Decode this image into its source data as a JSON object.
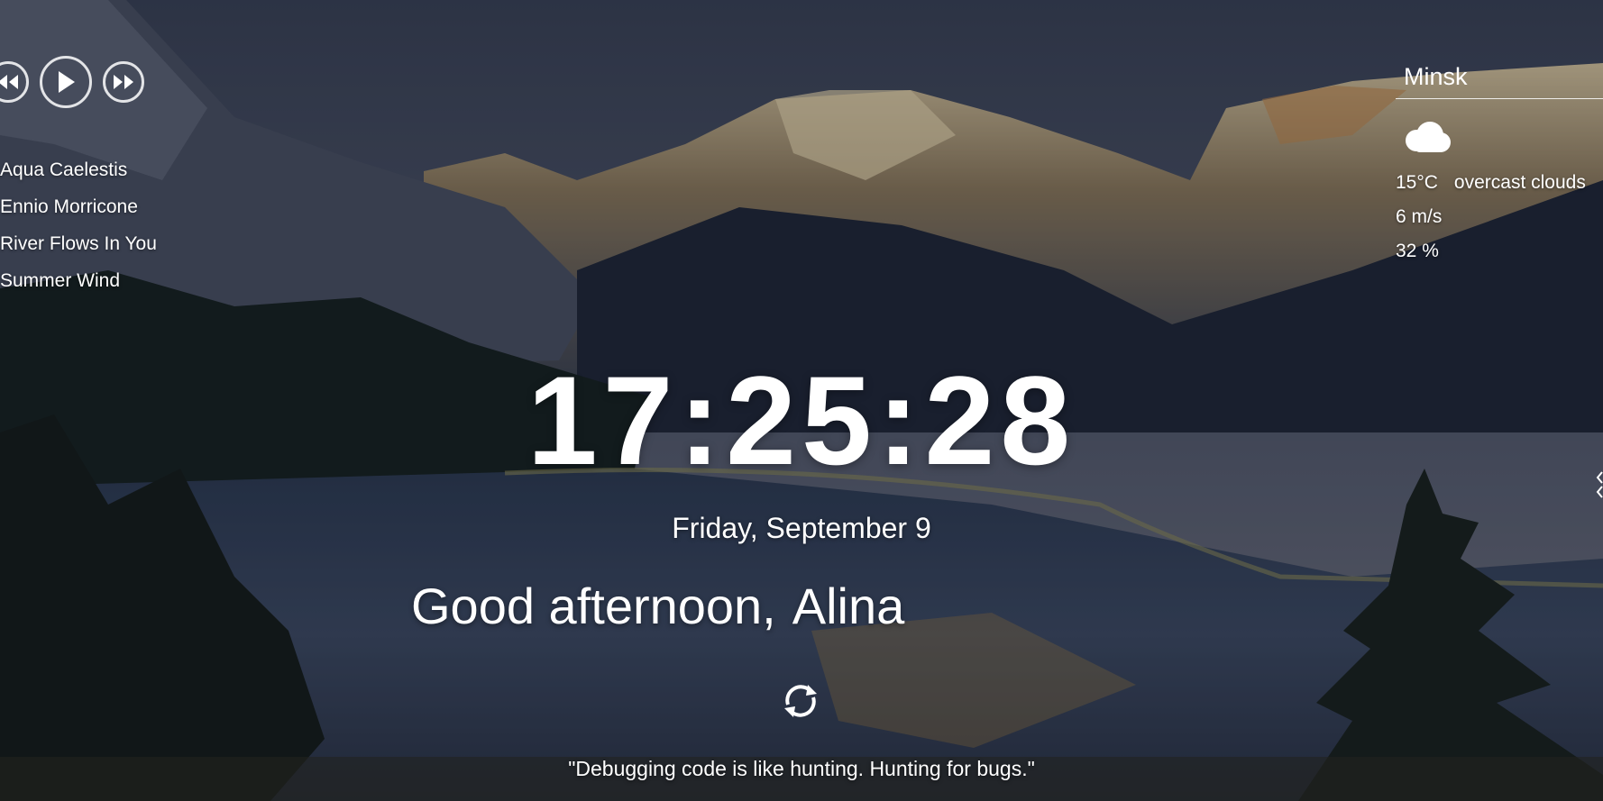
{
  "player": {
    "prev_icon": "prev-icon",
    "play_icon": "play-icon",
    "next_icon": "next-icon",
    "tracks": [
      "Aqua Caelestis",
      "Ennio Morricone",
      "River Flows In You",
      "Summer Wind"
    ]
  },
  "weather": {
    "city": "Minsk",
    "icon": "overcast-clouds-icon",
    "temperature": "15°C",
    "description": "overcast clouds",
    "wind": "6 m/s",
    "humidity": "32 %"
  },
  "clock": {
    "time": "17:25:28",
    "date": "Friday, September 9"
  },
  "greeting": {
    "text": "Good afternoon,",
    "name": "Alina"
  },
  "quote": {
    "refresh_icon": "refresh-icon",
    "text": "\"Debugging code is like hunting. Hunting for bugs.\""
  }
}
